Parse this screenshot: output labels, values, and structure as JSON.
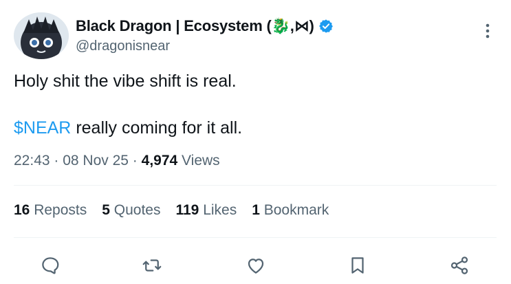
{
  "author": {
    "display_name": "Black Dragon | Ecosystem (🐉,⋈)",
    "handle": "@dragonisnear",
    "verified": true,
    "verified_color": "#1d9bf0"
  },
  "tweet": {
    "line1": "Holy shit the vibe shift is real.",
    "cashtag": "$NEAR",
    "line2_rest": " really coming for it all."
  },
  "meta": {
    "time": "22:43",
    "sep1": " · ",
    "date": "08 Nov 25",
    "sep2": " · ",
    "views_count": "4,974",
    "views_label": " Views"
  },
  "stats": [
    {
      "count": "16",
      "label": " Reposts"
    },
    {
      "count": "5",
      "label": " Quotes"
    },
    {
      "count": "119",
      "label": " Likes"
    },
    {
      "count": "1",
      "label": " Bookmark"
    }
  ],
  "actions": [
    "reply-icon",
    "repost-icon",
    "like-icon",
    "bookmark-icon",
    "share-icon"
  ],
  "colors": {
    "text": "#0f1419",
    "secondary": "#536471",
    "accent": "#1d9bf0",
    "divider": "#eff3f4"
  }
}
